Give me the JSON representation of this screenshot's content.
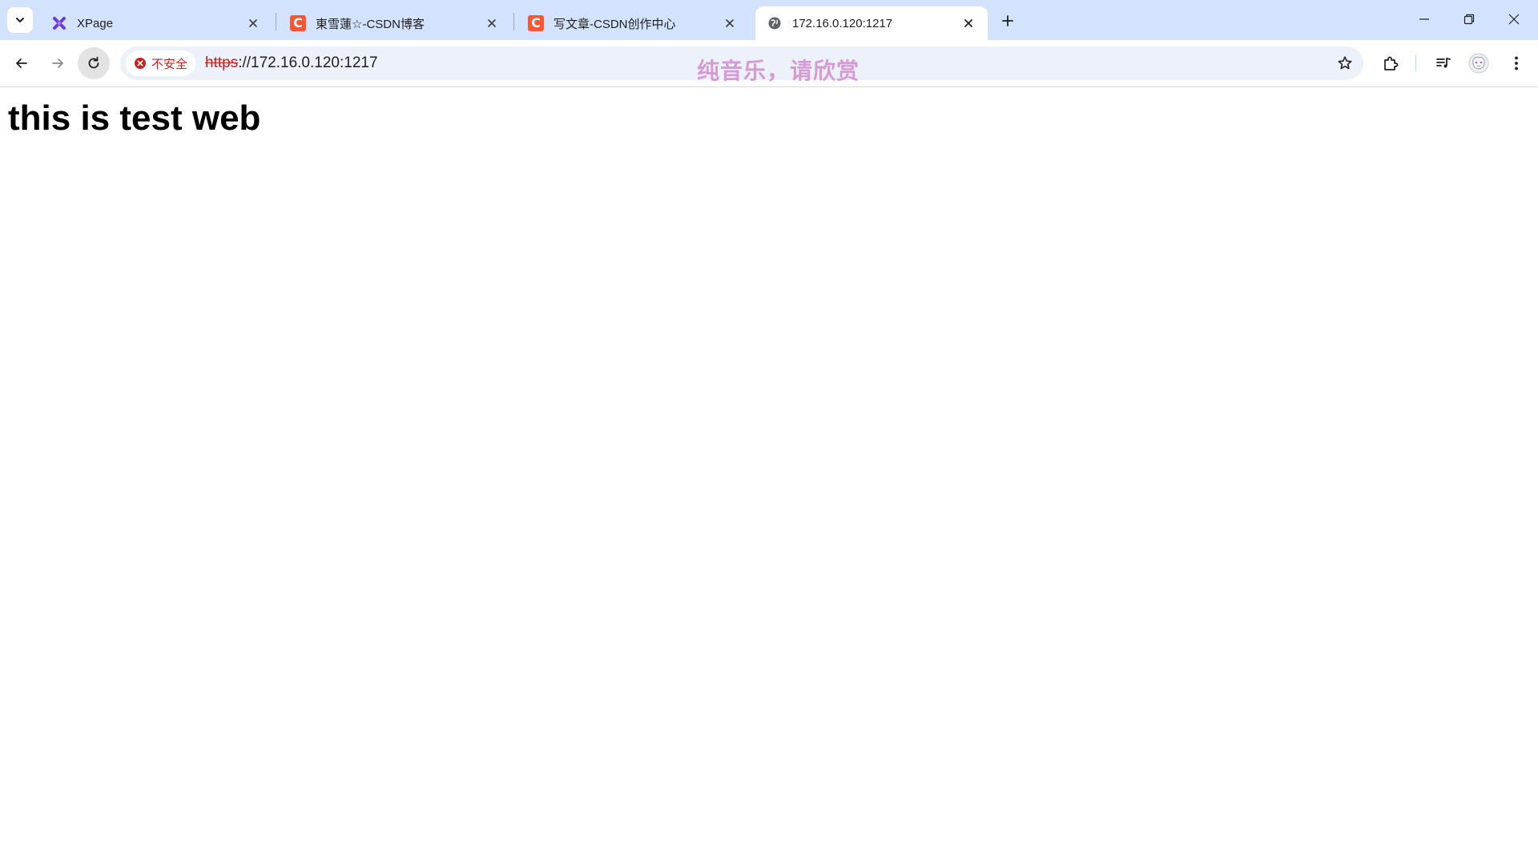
{
  "browser": {
    "tabs": [
      {
        "title": "XPage",
        "icon": "xpage-logo-icon",
        "active": false
      },
      {
        "title": "東雪蓮☆-CSDN博客",
        "icon": "csdn-logo-icon",
        "active": false
      },
      {
        "title": "写文章-CSDN创作中心",
        "icon": "csdn-logo-icon",
        "active": false
      },
      {
        "title": "172.16.0.120:1217",
        "icon": "globe-icon",
        "active": true
      }
    ],
    "csdn_favicon_letter": "C",
    "address_bar": {
      "security_label": "不安全",
      "url_scheme": "https",
      "url_rest": "://172.16.0.120:1217"
    },
    "overlay_caption": "纯音乐，请欣赏",
    "colors": {
      "tabstrip_bg": "#d3e3fd",
      "omnibox_bg": "#edf2fa",
      "insecure_red": "#c5221f",
      "csdn_brand": "#fc5531",
      "xpage_purple": "#6b3bd6",
      "overlay_pink": "#d69ad6"
    }
  },
  "page": {
    "heading": "this is test web"
  }
}
